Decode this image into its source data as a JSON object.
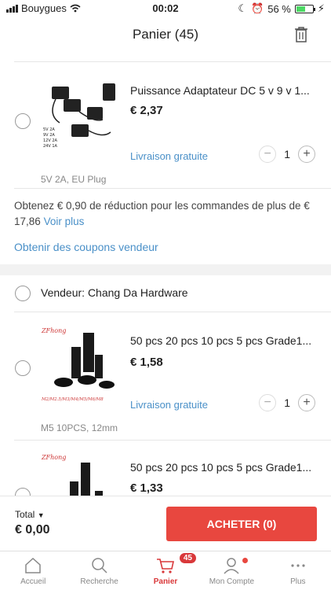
{
  "status": {
    "carrier": "Bouygues",
    "time": "00:02",
    "battery": "56 %"
  },
  "header": {
    "title": "Panier (45)"
  },
  "items_top": {
    "name": "Puissance Adaptateur DC 5 v 9 v 1...",
    "price": "€ 2,37",
    "shipping": "Livraison gratuite",
    "qty": "1",
    "variant": "5V 2A, EU Plug"
  },
  "promo": {
    "text": "Obtenez € 0,90 de réduction pour les commandes de plus de € 17,86",
    "link": "Voir plus",
    "coupon": "Obtenir des coupons vendeur"
  },
  "seller": {
    "label": "Vendeur: Chang Da Hardware"
  },
  "items": [
    {
      "name": "50 pcs 20 pcs 10 pcs 5 pcs Grade1...",
      "price": "€ 1,58",
      "shipping": "Livraison gratuite",
      "qty": "1",
      "variant": "M5 10PCS, 12mm",
      "thumb_top": "ZFhong",
      "thumb_bottom": "M2/M2.5/M3/M4/M5/M6/M8"
    },
    {
      "name": "50 pcs 20 pcs 10 pcs 5 pcs Grade1...",
      "price": "€ 1,33",
      "thumb_top": "ZFhong"
    }
  ],
  "footer": {
    "total_label": "Total",
    "total_value": "€ 0,00",
    "buy_label": "ACHETER (0)"
  },
  "tabs": [
    {
      "label": "Accueil"
    },
    {
      "label": "Recherche"
    },
    {
      "label": "Panier",
      "badge": "45"
    },
    {
      "label": "Mon Compte"
    },
    {
      "label": "Plus"
    }
  ]
}
